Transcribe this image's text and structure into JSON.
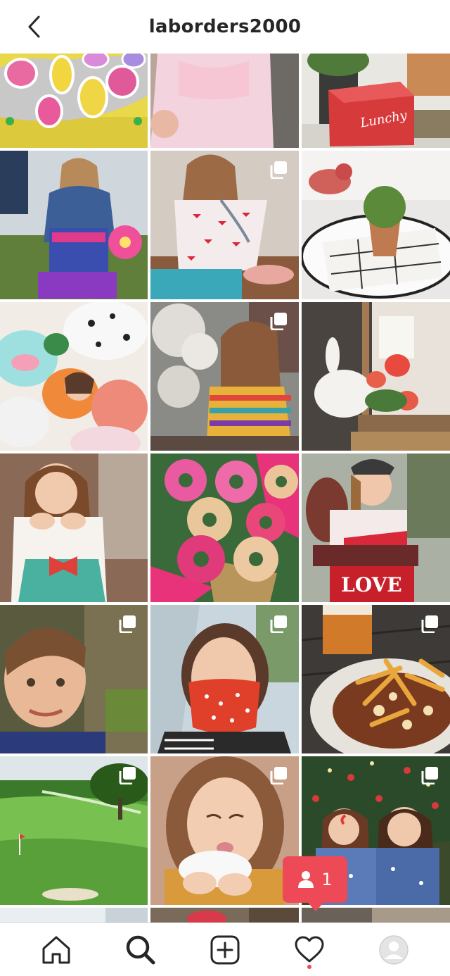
{
  "header": {
    "title": "laborders2000",
    "back_icon": "chevron-left-icon"
  },
  "grid": {
    "posts": [
      {
        "id": "p1",
        "scene": "Decorated cookies in heart, ice cream and butterfly shapes on yellow cloth",
        "multi": false
      },
      {
        "id": "p2",
        "scene": "Child in pink smocked dress",
        "multi": false
      },
      {
        "id": "p3",
        "scene": "Red Lunchy Club box on porch",
        "multi": false
      },
      {
        "id": "p4",
        "scene": "Girl in denim jacket with Trolls toy boxes and pink flower",
        "multi": false
      },
      {
        "id": "p5",
        "scene": "Girl in heart dress with toy stethoscope and baby doll",
        "multi": true
      },
      {
        "id": "p6",
        "scene": "Potted plant on plaid napkin and white plate table setting",
        "multi": false
      },
      {
        "id": "p7",
        "scene": "Girl surrounded by plush toys",
        "multi": false
      },
      {
        "id": "p8",
        "scene": "Girl in striped dress near white flowers",
        "multi": true
      },
      {
        "id": "p9",
        "scene": "White bunny figurine with candle and pink roses",
        "multi": false
      },
      {
        "id": "p10",
        "scene": "Smiling girl with hands on cheeks",
        "multi": false
      },
      {
        "id": "p11",
        "scene": "Pink sprinkle donuts bouquet",
        "multi": false
      },
      {
        "id": "p12",
        "scene": "Girl in cap on chair with LOVE sign",
        "multi": false
      },
      {
        "id": "p13",
        "scene": "Smiling boy portrait",
        "multi": true
      },
      {
        "id": "p14",
        "scene": "Woman wearing red patterned face mask",
        "multi": true
      },
      {
        "id": "p15",
        "scene": "Beer and loaded fries plate",
        "multi": true
      },
      {
        "id": "p16",
        "scene": "Golf course green with tree",
        "multi": true
      },
      {
        "id": "p17",
        "scene": "Girl blowing snow from hands",
        "multi": true
      },
      {
        "id": "p18",
        "scene": "Two children in pajamas by Christmas tree",
        "multi": true
      },
      {
        "id": "p19",
        "scene": "Partial post",
        "multi": false
      },
      {
        "id": "p20",
        "scene": "Partial post",
        "multi": true
      },
      {
        "id": "p21",
        "scene": "Partial post",
        "multi": false
      }
    ],
    "multi_icon": "carousel-icon"
  },
  "notification": {
    "count": "1",
    "icon": "person-icon",
    "color": "#ed4956"
  },
  "bottom_nav": {
    "items": [
      {
        "name": "home",
        "icon": "home-icon"
      },
      {
        "name": "search",
        "icon": "search-icon",
        "active": true
      },
      {
        "name": "new-post",
        "icon": "plus-square-icon"
      },
      {
        "name": "activity",
        "icon": "heart-icon",
        "has_dot": true
      },
      {
        "name": "profile",
        "icon": "avatar-icon"
      }
    ]
  },
  "colors": {
    "text": "#262626",
    "border": "#dbdbdb",
    "accent": "#ed4956",
    "background": "#ffffff"
  }
}
